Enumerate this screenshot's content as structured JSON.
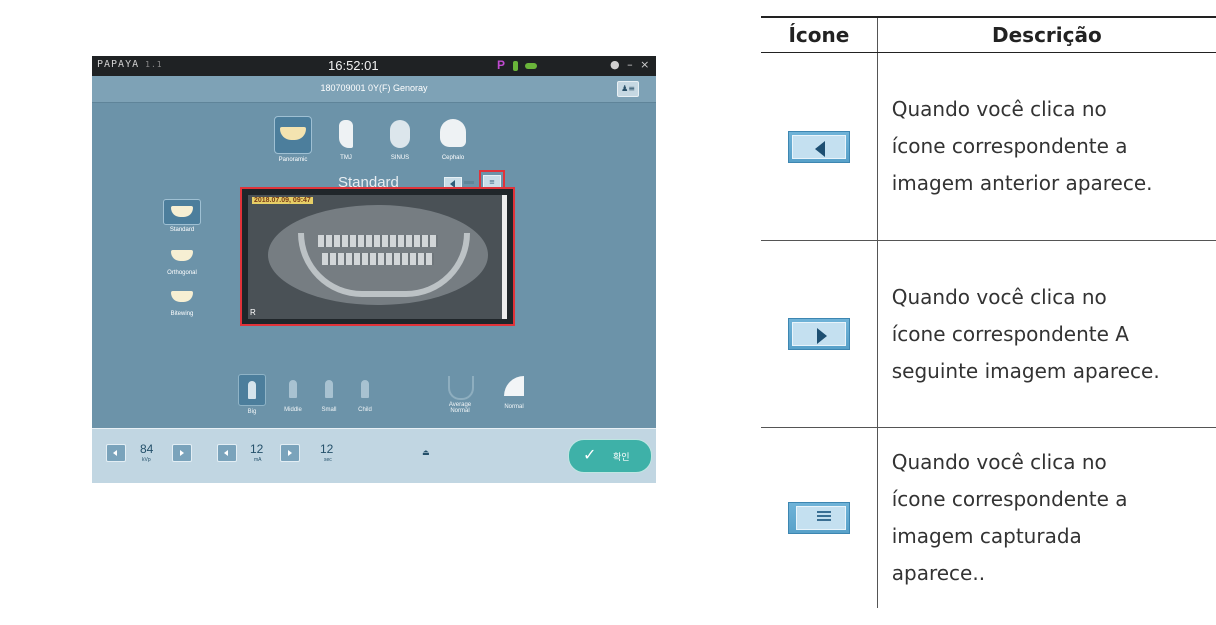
{
  "app": {
    "brand": "PAPAYA",
    "version": "1.1",
    "clock": "16:52:01",
    "status_letter": "P",
    "window_controls": "● – ×",
    "patient": "180709001   0Y(F)  Genoray",
    "patient_button": "♟≡",
    "modes": [
      {
        "label": "Panoramic",
        "icon": "panoramic-icon",
        "selected": true
      },
      {
        "label": "TMJ",
        "icon": "tmj-icon",
        "selected": false
      },
      {
        "label": "SINUS",
        "icon": "sinus-icon",
        "selected": false
      },
      {
        "label": "Cephalo",
        "icon": "cephalo-icon",
        "selected": false
      }
    ],
    "program": "Standard",
    "list_glyph": "≡",
    "side_options": [
      {
        "label": "Standard",
        "selected": true
      },
      {
        "label": "Orthogonal",
        "selected": false
      },
      {
        "label": "Bitewing",
        "selected": false
      }
    ],
    "image_timestamp": "2018.07.09, 09:47",
    "image_marker": "R",
    "body_sizes": [
      "Big",
      "Middle",
      "Small",
      "Child"
    ],
    "arch_label": "Average\nNormal",
    "arch_type": "Normal",
    "kvp": {
      "value": "84",
      "unit": "kVp"
    },
    "ma": {
      "value": "12",
      "unit": "mA"
    },
    "sec": {
      "value": "12",
      "unit": "sec"
    },
    "mid_icon": "⏏",
    "ok": {
      "check": "✓",
      "label": "확인"
    }
  },
  "table": {
    "header_icon": "Ícone",
    "header_desc": "Descrição",
    "rows": [
      {
        "icon": "previous-image-icon",
        "lines": [
          "Quando você clica no",
          "ícone correspondente a",
          "imagem anterior aparece."
        ]
      },
      {
        "icon": "next-image-icon",
        "lines": [
          "Quando você clica no",
          "ícone correspondente A",
          "seguinte imagem aparece."
        ]
      },
      {
        "icon": "captured-image-list-icon",
        "lines": [
          "Quando você clica no",
          "ícone correspondente a",
          "imagem capturada",
          "aparece.."
        ]
      }
    ]
  }
}
